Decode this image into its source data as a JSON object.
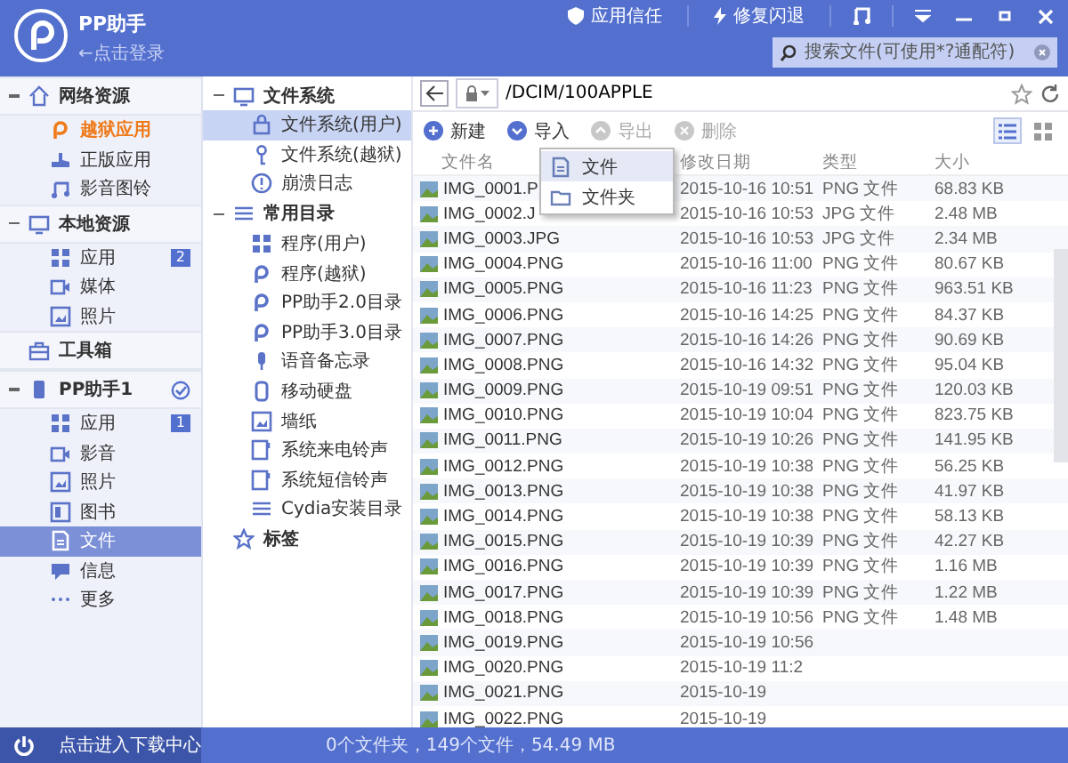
{
  "header": {
    "app_name": "PP助手",
    "login_hint": "←点击登录",
    "actions": [
      {
        "kind": "shield",
        "label": "应用信任"
      },
      {
        "kind": "bolt",
        "label": "修复闪退"
      }
    ],
    "search": {
      "placeholder": "搜索文件(可使用*?通配符)"
    }
  },
  "sidebar": [
    {
      "label": "网络资源",
      "kind": "home",
      "expanded": true,
      "checked": false,
      "children": [
        {
          "label": "越狱应用",
          "kind": "pp",
          "selected": false,
          "highlighted": true
        },
        {
          "label": "正版应用",
          "kind": "hand",
          "selected": false,
          "highlighted": false
        },
        {
          "label": "影音图铃",
          "kind": "music",
          "selected": false,
          "highlighted": false
        }
      ]
    },
    {
      "label": "本地资源",
      "kind": "monitor",
      "expanded": true,
      "checked": false,
      "children": [
        {
          "label": "应用",
          "kind": "grid",
          "badge": "2",
          "selected": false,
          "highlighted": false
        },
        {
          "label": "媒体",
          "kind": "video",
          "selected": false,
          "highlighted": false
        },
        {
          "label": "照片",
          "kind": "photo",
          "selected": false,
          "highlighted": false
        }
      ]
    },
    {
      "label": "工具箱",
      "kind": "toolbox",
      "expanded": false,
      "checked": false
    },
    {
      "label": "PP助手1",
      "kind": "phone",
      "expanded": true,
      "checked": true,
      "children": [
        {
          "label": "应用",
          "kind": "grid",
          "badge": "1",
          "selected": false,
          "highlighted": false
        },
        {
          "label": "影音",
          "kind": "video",
          "selected": false,
          "highlighted": false
        },
        {
          "label": "照片",
          "kind": "photo",
          "selected": false,
          "highlighted": false
        },
        {
          "label": "图书",
          "kind": "book",
          "selected": false,
          "highlighted": false
        },
        {
          "label": "文件",
          "kind": "file",
          "selected": true,
          "highlighted": false
        },
        {
          "label": "信息",
          "kind": "chat",
          "selected": false,
          "highlighted": false
        },
        {
          "label": "更多",
          "kind": "dots",
          "selected": false,
          "highlighted": false
        }
      ]
    }
  ],
  "download_center": "点击进入下载中心",
  "directory_tree": [
    {
      "label": "文件系统",
      "kind": "monitor",
      "expanded": true,
      "children": [
        {
          "label": "文件系统(用户)",
          "kind": "lock",
          "selected": true
        },
        {
          "label": "文件系统(越狱)",
          "kind": "key",
          "selected": false
        },
        {
          "label": "崩溃日志",
          "kind": "info",
          "selected": false
        }
      ]
    },
    {
      "label": "常用目录",
      "kind": "list",
      "expanded": true,
      "children": [
        {
          "label": "程序(用户)",
          "kind": "grid",
          "selected": false
        },
        {
          "label": "程序(越狱)",
          "kind": "pp",
          "selected": false
        },
        {
          "label": "PP助手2.0目录",
          "kind": "pp",
          "selected": false
        },
        {
          "label": "PP助手3.0目录",
          "kind": "pp",
          "selected": false
        },
        {
          "label": "语音备忘录",
          "kind": "mic",
          "selected": false
        },
        {
          "label": "移动硬盘",
          "kind": "drive",
          "selected": false
        },
        {
          "label": "墙纸",
          "kind": "photo",
          "selected": false
        },
        {
          "label": "系统来电铃声",
          "kind": "bell",
          "selected": false
        },
        {
          "label": "系统短信铃声",
          "kind": "bell",
          "selected": false
        },
        {
          "label": "Cydia安装目录",
          "kind": "list",
          "selected": false
        }
      ]
    },
    {
      "label": "标签",
      "kind": "star",
      "expanded": false
    }
  ],
  "path": "/DCIM/100APPLE",
  "toolbar": [
    {
      "label": "新建",
      "kind": "new",
      "disabled": false
    },
    {
      "label": "导入",
      "kind": "import",
      "disabled": false
    },
    {
      "label": "导出",
      "kind": "export",
      "disabled": true
    },
    {
      "label": "删除",
      "kind": "delete",
      "disabled": true
    }
  ],
  "view_modes": [
    {
      "kind": "list",
      "selected": true
    },
    {
      "kind": "grid",
      "selected": false
    }
  ],
  "import_menu": [
    {
      "label": "文件",
      "kind": "file",
      "selected": true
    },
    {
      "label": "文件夹",
      "kind": "folder",
      "selected": false
    }
  ],
  "table": {
    "columns": [
      "文件名",
      "修改日期",
      "类型",
      "大小"
    ],
    "rows": [
      [
        "IMG_0001.P",
        "2015-10-16 10:51",
        "PNG 文件",
        "68.83 KB"
      ],
      [
        "IMG_0002.J",
        "2015-10-16 10:53",
        "JPG 文件",
        "2.48 MB"
      ],
      [
        "IMG_0003.JPG",
        "2015-10-16 10:53",
        "JPG 文件",
        "2.34 MB"
      ],
      [
        "IMG_0004.PNG",
        "2015-10-16 11:00",
        "PNG 文件",
        "80.67 KB"
      ],
      [
        "IMG_0005.PNG",
        "2015-10-16 11:23",
        "PNG 文件",
        "963.51 KB"
      ],
      [
        "IMG_0006.PNG",
        "2015-10-16 14:25",
        "PNG 文件",
        "84.37 KB"
      ],
      [
        "IMG_0007.PNG",
        "2015-10-16 14:26",
        "PNG 文件",
        "90.69 KB"
      ],
      [
        "IMG_0008.PNG",
        "2015-10-16 14:32",
        "PNG 文件",
        "95.04 KB"
      ],
      [
        "IMG_0009.PNG",
        "2015-10-19 09:51",
        "PNG 文件",
        "120.03 KB"
      ],
      [
        "IMG_0010.PNG",
        "2015-10-19 10:04",
        "PNG 文件",
        "823.75 KB"
      ],
      [
        "IMG_0011.PNG",
        "2015-10-19 10:26",
        "PNG 文件",
        "141.95 KB"
      ],
      [
        "IMG_0012.PNG",
        "2015-10-19 10:38",
        "PNG 文件",
        "56.25 KB"
      ],
      [
        "IMG_0013.PNG",
        "2015-10-19 10:38",
        "PNG 文件",
        "41.97 KB"
      ],
      [
        "IMG_0014.PNG",
        "2015-10-19 10:38",
        "PNG 文件",
        "58.13 KB"
      ],
      [
        "IMG_0015.PNG",
        "2015-10-19 10:39",
        "PNG 文件",
        "42.27 KB"
      ],
      [
        "IMG_0016.PNG",
        "2015-10-19 10:39",
        "PNG 文件",
        "1.16 MB"
      ],
      [
        "IMG_0017.PNG",
        "2015-10-19 10:39",
        "PNG 文件",
        "1.22 MB"
      ],
      [
        "IMG_0018.PNG",
        "2015-10-19 10:56",
        "PNG 文件",
        "1.48 MB"
      ],
      [
        "IMG_0019.PNG",
        "2015-10-19 10:56"
      ],
      [
        "IMG_0020.PNG",
        "2015-10-19 11:2"
      ],
      [
        "IMG_0021.PNG",
        "2015-10-19"
      ],
      [
        "IMG_0022.PNG",
        "2015-10-19"
      ]
    ]
  },
  "status_bar": "0个文件夹，149个文件，54.49 MB"
}
